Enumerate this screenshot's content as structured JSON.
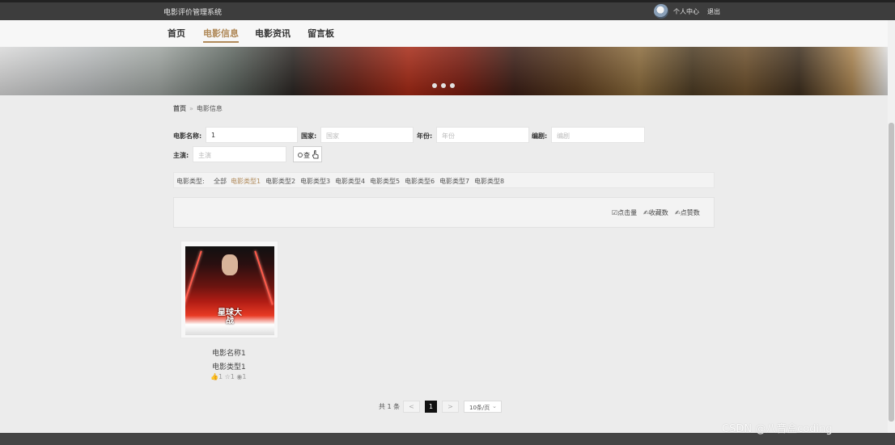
{
  "topbar": {
    "brand": "电影评价管理系统",
    "user_center": "个人中心",
    "logout": "退出"
  },
  "nav": {
    "items": [
      "首页",
      "电影信息",
      "电影资讯",
      "留言板"
    ],
    "active": "电影信息"
  },
  "breadcrumb": {
    "home": "首页",
    "sep": "»",
    "current": "电影信息"
  },
  "filters": {
    "name_label": "电影名称:",
    "name_value": "1",
    "country_label": "国家:",
    "country_placeholder": "国家",
    "year_label": "年份:",
    "year_placeholder": "年份",
    "director_label": "编剧:",
    "director_placeholder": "编剧",
    "actor_label": "主演:",
    "actor_placeholder": "主演",
    "search_label": "查"
  },
  "types": {
    "label": "电影类型:",
    "items": [
      "全部",
      "电影类型1",
      "电影类型2",
      "电影类型3",
      "电影类型4",
      "电影类型5",
      "电影类型6",
      "电影类型7",
      "电影类型8"
    ],
    "active": "电影类型1"
  },
  "sort": {
    "clicks": "☑点击量",
    "favorites": "✍收藏数",
    "likes": "✍点赞数"
  },
  "movie": {
    "name": "电影名称1",
    "type": "电影类型1",
    "stats": "👍1 ☆1 ◉1",
    "poster_title": "星球大战"
  },
  "pager": {
    "total": "共 1 条",
    "prev": "<",
    "current": "1",
    "next": ">",
    "page_size": "10条/页"
  },
  "watermark": "CSDN @八音盒coding",
  "colors": {
    "accent": "#b08a5a",
    "topbar": "#3d3d3d"
  }
}
